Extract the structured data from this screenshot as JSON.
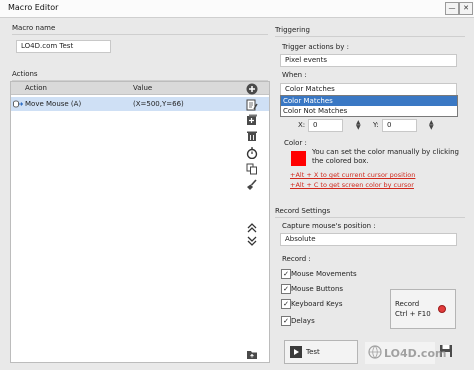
{
  "window": {
    "title": "Macro Editor",
    "min_label": "—",
    "close_label": "✕"
  },
  "macro_name": {
    "label": "Macro name",
    "value": "LO4D.com Test"
  },
  "actions": {
    "label": "Actions",
    "columns": [
      "Action",
      "Value"
    ],
    "rows": [
      {
        "action": "Move Mouse (A)",
        "value": "(X=500,Y=66)"
      }
    ]
  },
  "triggering": {
    "label": "Triggering",
    "trigger_label": "Trigger actions by :",
    "trigger_value": "Pixel events",
    "when_label": "When :",
    "when_value": "Color Matches",
    "when_options": [
      "Color Matches",
      "Color Not Matches"
    ],
    "x_label": "X:",
    "x_value": "0",
    "y_label": "Y:",
    "y_value": "0",
    "color_label": "Color :",
    "color_hex": "#ff0000",
    "color_hint": "You can set the color manually by clicking the colored box.",
    "alt_x_link": "+Alt + X to get current cursor position",
    "alt_c_link": "+Alt + C to get screen color by cursor"
  },
  "record_settings": {
    "label": "Record Settings",
    "capture_label": "Capture mouse's position :",
    "capture_value": "Absolute",
    "record_label": "Record :",
    "checkboxes": [
      "Mouse Movements",
      "Mouse Buttons",
      "Keyboard Keys",
      "Delays"
    ],
    "record_button_line1": "Record",
    "record_button_line2": "Ctrl + F10"
  },
  "test_button": "Test",
  "watermark": "LO4D.com",
  "colors": {
    "accent": "#3a78c4",
    "record_dot": "#e23b3b"
  }
}
